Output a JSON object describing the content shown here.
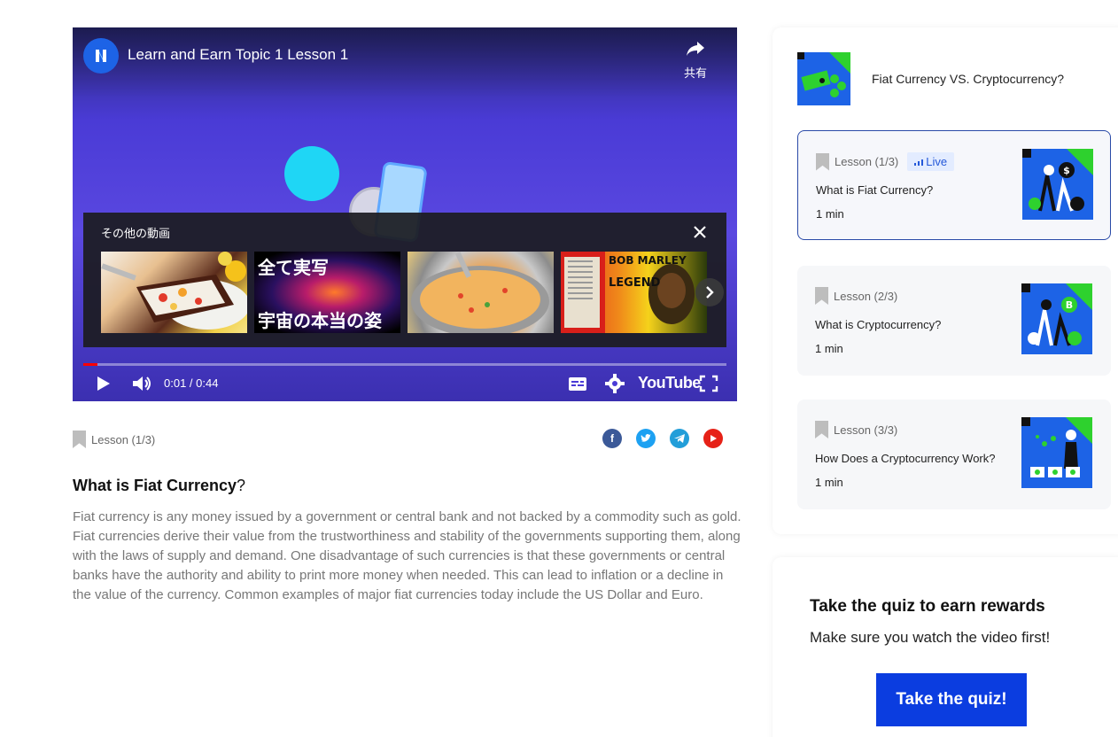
{
  "video": {
    "title": "Learn and Earn Topic 1 Lesson 1",
    "share_label": "共有",
    "more_videos_title": "その他の動画",
    "thumbnails": [
      {
        "text1": "",
        "text2": ""
      },
      {
        "text1": "全て実写",
        "text2": "宇宙の本当の姿"
      },
      {
        "text1": "",
        "text2": ""
      },
      {
        "text1": "BOB MARLEY",
        "text2": "LEGEND"
      }
    ],
    "time": "0:01 / 0:44",
    "progress": 0.0227,
    "youtube_label": "YouTube"
  },
  "lesson_meta": {
    "tag": "Lesson (1/3)"
  },
  "main": {
    "heading": "What is Fiat Currency",
    "heading_suffix": "?",
    "body": "Fiat currency is any money issued by a government or central bank and not backed by a commodity such as gold. Fiat currencies derive their value from the trustworthiness and stability of the governments supporting them, along with the laws of supply and demand. One disadvantage of such currencies is that these governments or central banks have the authority and ability to print more money when needed. This can lead to inflation or a decline in the value of the currency. Common examples of major fiat currencies today include the US Dollar and Euro."
  },
  "sidebar": {
    "course_title": "Fiat Currency VS. Cryptocurrency?",
    "lessons": [
      {
        "tag": "Lesson (1/3)",
        "live": "Live",
        "title": "What is Fiat Currency?",
        "duration": "1 min",
        "active": true
      },
      {
        "tag": "Lesson (2/3)",
        "live": "",
        "title": "What is Cryptocurrency?",
        "duration": "1 min",
        "active": false
      },
      {
        "tag": "Lesson (3/3)",
        "live": "",
        "title": "How Does a Cryptocurrency Work?",
        "duration": "1 min",
        "active": false
      }
    ]
  },
  "quiz": {
    "title": "Take the quiz to earn rewards",
    "subtitle": "Make sure you watch the video first!",
    "button": "Take the quiz!"
  },
  "colors": {
    "accent": "#0b3de0",
    "live_badge_bg": "#e3ecff",
    "active_border": "#2a4aa8",
    "facebook": "#3b5998",
    "twitter": "#1da1f2",
    "telegram": "#229ed9",
    "youtube": "#e62117"
  }
}
